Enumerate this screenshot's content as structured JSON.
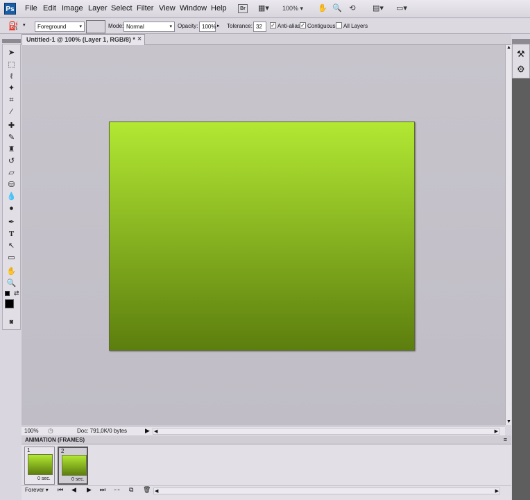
{
  "app": {
    "logo": "Ps"
  },
  "menu": [
    "File",
    "Edit",
    "Image",
    "Layer",
    "Select",
    "Filter",
    "View",
    "Window",
    "Help"
  ],
  "appbar": {
    "bridge": "Br",
    "zoom": "100%"
  },
  "options": {
    "fill_source": "Foreground",
    "mode_label": "Mode:",
    "mode": "Normal",
    "opacity_label": "Opacity:",
    "opacity": "100%",
    "tolerance_label": "Tolerance:",
    "tolerance": "32",
    "anti_alias": "Anti-alias",
    "contiguous": "Contiguous",
    "all_layers": "All Layers",
    "anti_alias_checked": true,
    "contiguous_checked": true,
    "all_layers_checked": false
  },
  "document": {
    "tab_title": "Untitled-1 @ 100% (Layer 1, RGB/8) *",
    "gradient_top": "#b2e833",
    "gradient_bottom": "#5c7e0e"
  },
  "status": {
    "zoom": "100%",
    "doc_info": "Doc: 791,0K/0 bytes"
  },
  "animation": {
    "title": "ANIMATION (FRAMES)",
    "frames": [
      {
        "number": "1",
        "delay": "0 sec."
      },
      {
        "number": "2",
        "delay": "0 sec."
      }
    ],
    "loop": "Forever"
  },
  "icons": {
    "tools": [
      "move-icon",
      "marquee-icon",
      "lasso-icon",
      "magic-wand-icon",
      "crop-icon",
      "eyedropper-icon",
      "healing-brush-icon",
      "brush-icon",
      "clone-stamp-icon",
      "history-brush-icon",
      "eraser-icon",
      "paint-bucket-icon",
      "blur-icon",
      "dodge-icon",
      "pen-icon",
      "type-icon",
      "path-selection-icon",
      "shape-icon",
      "hand-icon",
      "zoom-icon"
    ]
  }
}
